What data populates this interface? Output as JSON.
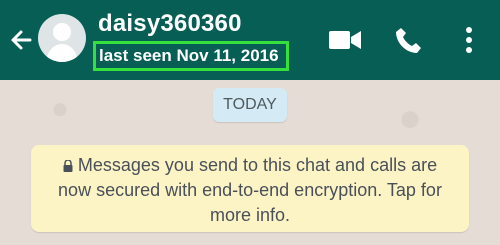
{
  "header": {
    "name": "daisy360360",
    "last_seen": "last seen Nov 11, 2016"
  },
  "chat": {
    "date_label": "TODAY",
    "encryption_notice": "Messages you send to this chat and calls are now secured with end-to-end encryption. Tap for more info."
  },
  "icons": [
    "back-arrow-icon",
    "avatar-icon",
    "video-call-icon",
    "phone-icon",
    "more-options-icon",
    "lock-icon"
  ],
  "colors": {
    "header": "#075e54",
    "chat_background": "#e5ddd5",
    "highlight": "#35e03c",
    "notice_background": "#fdf4c5",
    "date_chip": "#d4eaf4"
  }
}
